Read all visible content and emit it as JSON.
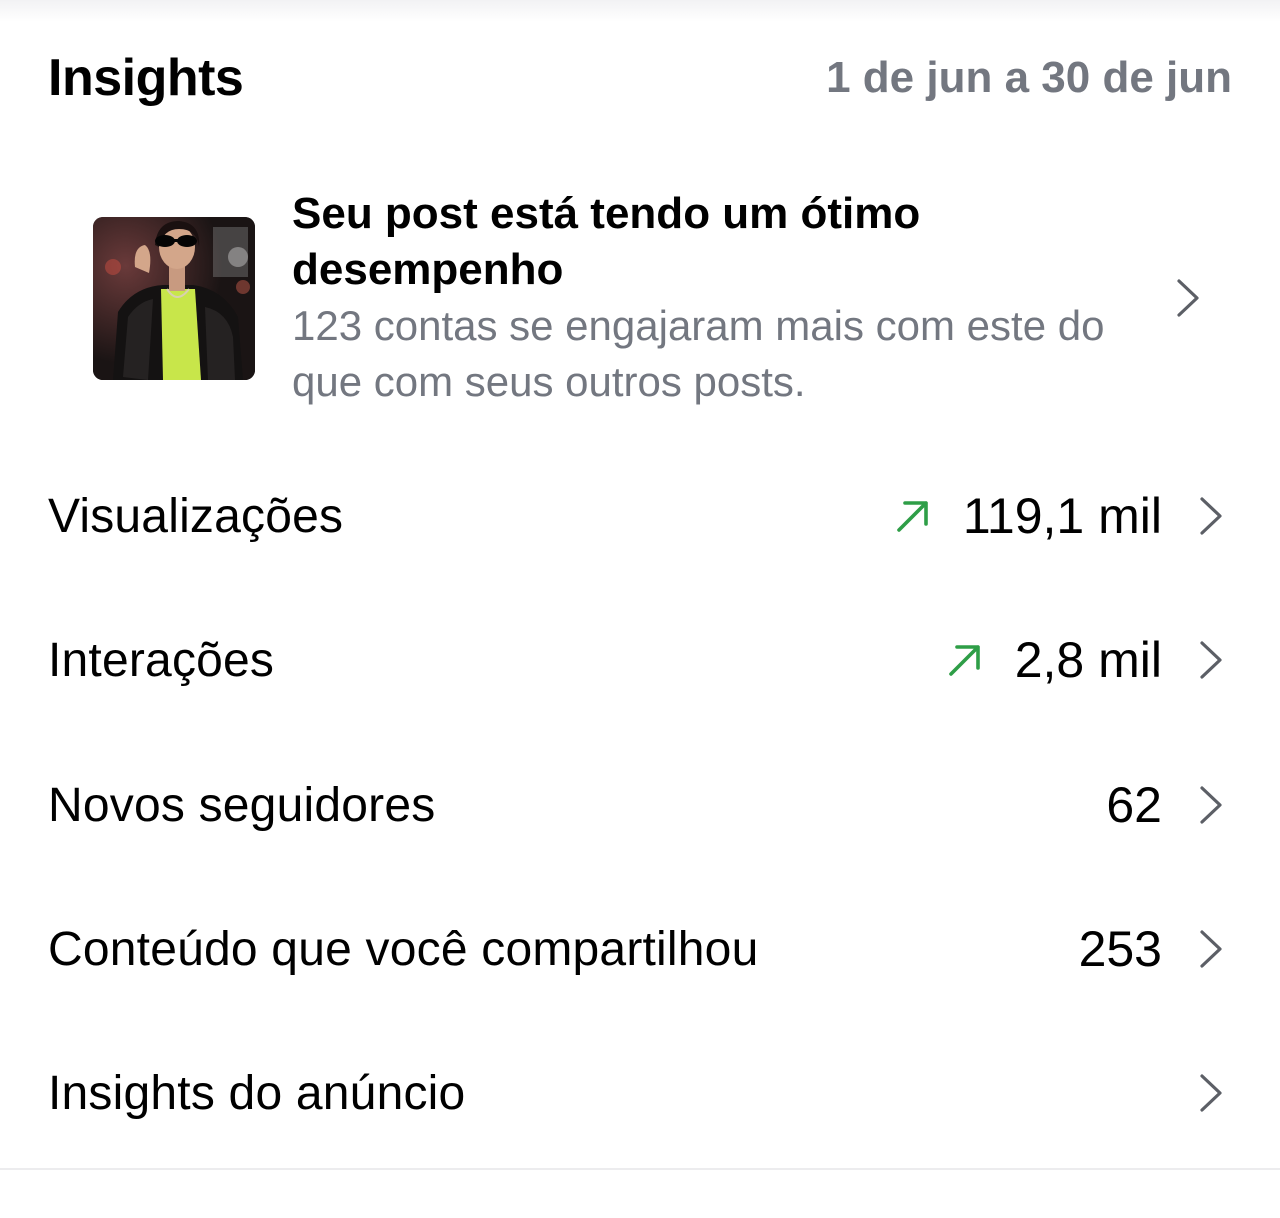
{
  "header": {
    "title": "Insights",
    "date_range": "1 de jun a 30 de jun"
  },
  "banner": {
    "title": "Seu post está tendo um ótimo desempenho",
    "subtitle": "123 contas se engajaram mais com este do que com seus outros posts.",
    "thumbnail_icon": "post-thumbnail-image"
  },
  "metrics": [
    {
      "label": "Visualizações",
      "value": "119,1 mil",
      "trend": "up"
    },
    {
      "label": "Interações",
      "value": "2,8 mil",
      "trend": "up"
    },
    {
      "label": "Novos seguidores",
      "value": "62",
      "trend": ""
    },
    {
      "label": "Conteúdo que você compartilhou",
      "value": "253",
      "trend": ""
    },
    {
      "label": "Insights do anúncio",
      "value": "",
      "trend": ""
    }
  ],
  "colors": {
    "trend_up": "#2e9e47",
    "secondary_text": "#737780",
    "chevron": "#5c5f66"
  }
}
